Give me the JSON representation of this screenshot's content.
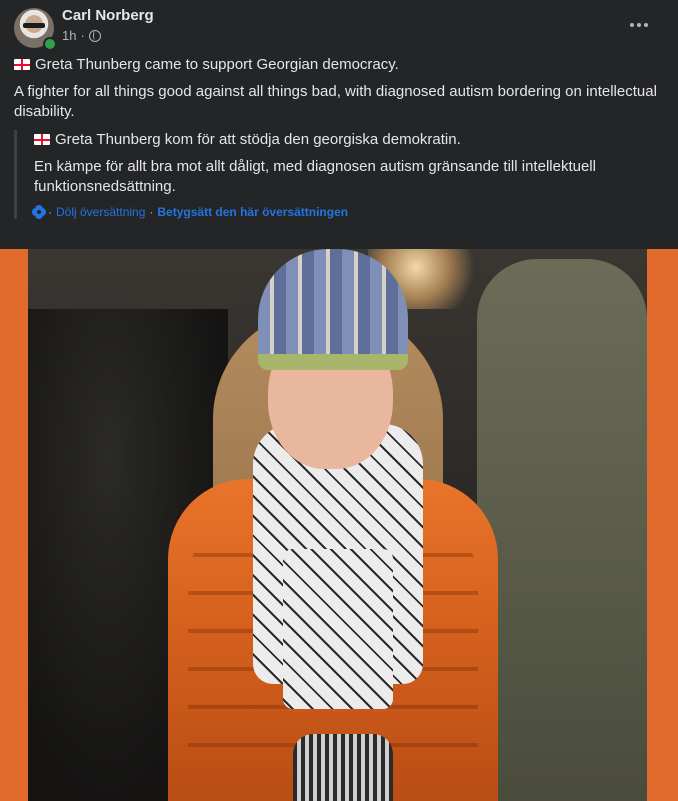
{
  "post": {
    "author": "Carl Norberg",
    "time": "1h",
    "separator": "·",
    "audience_icon": "globe-icon",
    "more_icon": "more-options-icon",
    "text": {
      "line1": "Greta Thunberg came to support Georgian democracy.",
      "line2": "A fighter for all things good against all things bad, with diagnosed autism bordering on intellectual disability."
    },
    "translation": {
      "line1": "Greta Thunberg kom för att stödja den georgiska demokratin.",
      "line2": "En kämpe för allt bra mot allt dåligt, med diagnosen autism gränsande till intellektuell funktionsnedsättning.",
      "hide_label": "Dölj översättning",
      "rate_label": "Betygsätt den här översättningen",
      "sep": "·"
    },
    "image": {
      "alt_subject": "photo"
    }
  },
  "colors": {
    "background": "#242526",
    "text": "#e4e6eb",
    "secondary_text": "#b0b3b8",
    "link": "#2374e1",
    "online": "#31a24c",
    "photo_border": "#e06b2c"
  }
}
